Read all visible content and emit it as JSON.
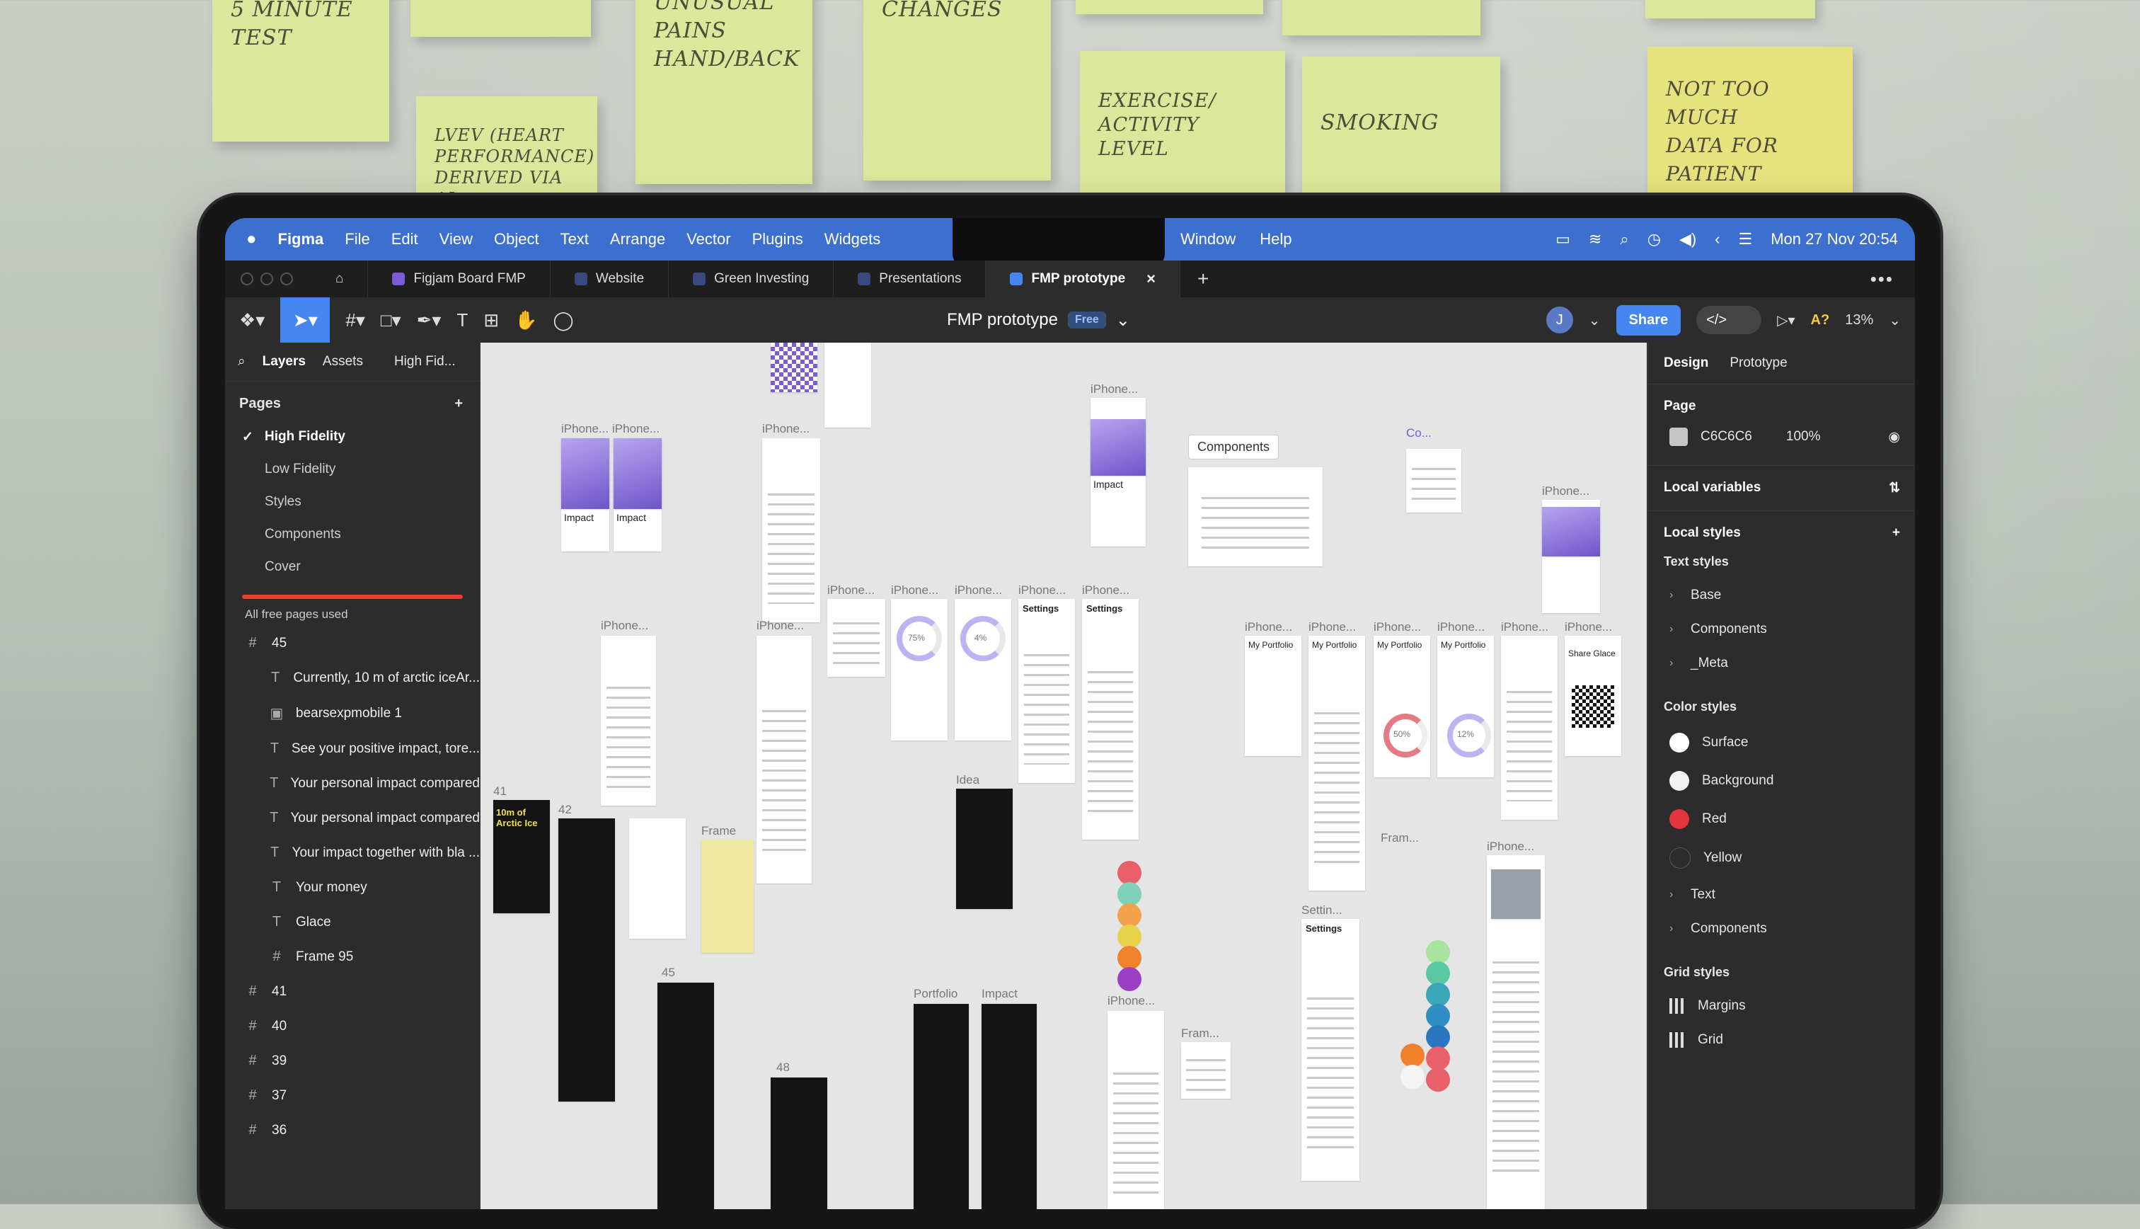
{
  "sticky_notes": [
    {
      "lines": [
        "5 MINUTE",
        "TEST"
      ]
    },
    {
      "lines": []
    },
    {
      "lines": [
        "UNUSUAL",
        "PAINS",
        "HAND/BACK"
      ]
    },
    {
      "lines": [
        "CHANGES"
      ]
    },
    {
      "lines": []
    },
    {
      "lines": []
    },
    {
      "lines": []
    },
    {
      "lines": [
        "LVEV (HEART",
        "PERFORMANCE)",
        "DERIVED VIA AI"
      ]
    },
    {
      "lines": [
        "EXERCISE/",
        "ACTIVITY",
        "LEVEL"
      ]
    },
    {
      "lines": [
        "SMOKING"
      ]
    },
    {
      "lines": [
        "NOT TOO MUCH",
        "DATA FOR",
        "PATIENT"
      ]
    }
  ],
  "menubar": {
    "app": "Figma",
    "menus": [
      "File",
      "Edit",
      "View",
      "Object",
      "Text",
      "Arrange",
      "Vector",
      "Plugins",
      "Widgets"
    ],
    "right_menus": [
      "Window",
      "Help"
    ],
    "clock": "Mon 27 Nov  20:54"
  },
  "tabs": [
    {
      "label": "Figjam Board FMP",
      "color": "#7b5cd6"
    },
    {
      "label": "Website",
      "color": "#3a4a80"
    },
    {
      "label": "Green Investing",
      "color": "#3a4a80"
    },
    {
      "label": "Presentations",
      "color": "#3a4a80"
    },
    {
      "label": "FMP prototype",
      "color": "#3a4a80",
      "active": true
    }
  ],
  "toolbar": {
    "doc_title": "FMP prototype",
    "plan_badge": "Free",
    "avatar_initial": "J",
    "share_label": "Share",
    "ai_label": "A?",
    "zoom": "13%"
  },
  "left_panel": {
    "tabs": [
      "Layers",
      "Assets"
    ],
    "page_selector": "High Fid...",
    "pages_heading": "Pages",
    "pages": [
      "High Fidelity",
      "Low Fidelity",
      "Styles",
      "Components",
      "Cover"
    ],
    "current_page": "High Fidelity",
    "pages_warning": "All free pages used",
    "layers": [
      {
        "icon": "#",
        "label": "45",
        "child": false
      },
      {
        "icon": "T",
        "label": "Currently, 10 m of arctic iceAr...",
        "child": true
      },
      {
        "icon": "▣",
        "label": "bearsexpmobile 1",
        "child": true
      },
      {
        "icon": "T",
        "label": "See your positive impact, tore...",
        "child": true
      },
      {
        "icon": "T",
        "label": "Your personal impact compared",
        "child": true
      },
      {
        "icon": "T",
        "label": "Your personal impact compared",
        "child": true
      },
      {
        "icon": "T",
        "label": "Your impact together with bla ...",
        "child": true
      },
      {
        "icon": "T",
        "label": "Your money",
        "child": true
      },
      {
        "icon": "T",
        "label": "Glace",
        "child": true
      },
      {
        "icon": "#",
        "label": "Frame 95",
        "child": true
      },
      {
        "icon": "#",
        "label": "41",
        "child": false
      },
      {
        "icon": "#",
        "label": "40",
        "child": false
      },
      {
        "icon": "#",
        "label": "39",
        "child": false
      },
      {
        "icon": "#",
        "label": "37",
        "child": false
      },
      {
        "icon": "#",
        "label": "36",
        "child": false
      }
    ]
  },
  "canvas": {
    "labels": {
      "iphone": "iPhone...",
      "impact": "Impact",
      "components": "Components",
      "component_set": "Co...",
      "settings": "Settings",
      "my_portfolio": "My Portfolio",
      "share_glace": "Share Glace",
      "idea": "Idea",
      "portfolio": "Portfolio",
      "frame": "Frame",
      "fram": "Fram...",
      "settin": "Settin...",
      "n41": "41",
      "n42": "42",
      "n45": "45",
      "n48": "48",
      "arctic": "10m of Arctic Ice",
      "pct1": "75%",
      "pct2": "4%",
      "pct3": "50%",
      "pct4": "12%"
    },
    "palette_colors": [
      "#e8606a",
      "#7ed0b8",
      "#f2a24a",
      "#e6d34a",
      "#f0842e",
      "#9d3fc2"
    ],
    "palette2_colors": [
      "#a8e6a0",
      "#5ac8a0",
      "#3aa7b8",
      "#2f8fc4",
      "#2a76c0"
    ],
    "palette3_colors": [
      "#f0822e",
      "#e8606a",
      "#f5f5f5",
      "#e8606a"
    ]
  },
  "right_panel": {
    "tabs": [
      "Design",
      "Prototype"
    ],
    "page_heading": "Page",
    "page_color": "C6C6C6",
    "page_opacity": "100%",
    "local_variables": "Local variables",
    "local_styles": "Local styles",
    "text_styles_heading": "Text styles",
    "text_styles": [
      "Base",
      "Components",
      "_Meta"
    ],
    "color_styles_heading": "Color styles",
    "color_styles": [
      {
        "name": "Surface",
        "color": "#ffffff"
      },
      {
        "name": "Background",
        "color": "#f2f2f2"
      },
      {
        "name": "Red",
        "color": "#e4343c"
      },
      {
        "name": "Yellow",
        "color": "#2c2c2c"
      }
    ],
    "color_groups": [
      "Text",
      "Components"
    ],
    "grid_styles_heading": "Grid styles",
    "grid_styles": [
      "Margins",
      "Grid"
    ]
  }
}
